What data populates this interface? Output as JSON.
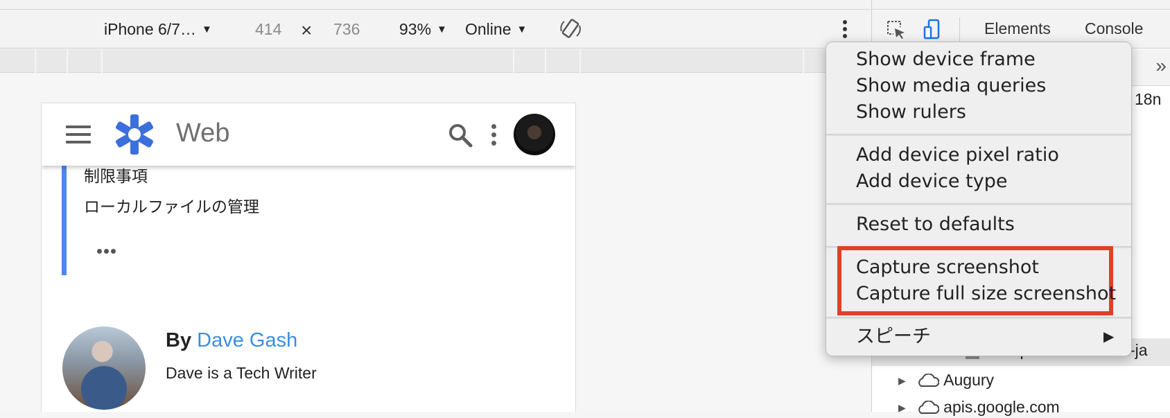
{
  "toolbar": {
    "device": "iPhone 6/7…",
    "width": "414",
    "times": "×",
    "height": "736",
    "zoom": "93%",
    "network": "Online"
  },
  "page": {
    "app_title": "Web",
    "toc_items": [
      "制限事項",
      "ローカルファイルの管理"
    ],
    "author_by": "By",
    "author_name": "Dave Gash",
    "author_desc": "Dave is a Tech Writer"
  },
  "devtools": {
    "tabs": [
      "Elements",
      "Console"
    ],
    "overflow": "»",
    "partial_text": "18n",
    "highlight_row": "setup-workflow.html-ja",
    "tree_rows": [
      "Augury",
      "apis.google.com"
    ]
  },
  "menu": {
    "groups": [
      [
        "Show device frame",
        "Show media queries",
        "Show rulers"
      ],
      [
        "Add device pixel ratio",
        "Add device type"
      ],
      [
        "Reset to defaults"
      ],
      [
        "Capture screenshot",
        "Capture full size screenshot"
      ],
      [
        "スピーチ"
      ]
    ],
    "highlight_color": "#e0402b"
  },
  "colors": {
    "accent": "#4f87ed",
    "link": "#3a8ee0",
    "devtools_active": "#1a73e8"
  }
}
